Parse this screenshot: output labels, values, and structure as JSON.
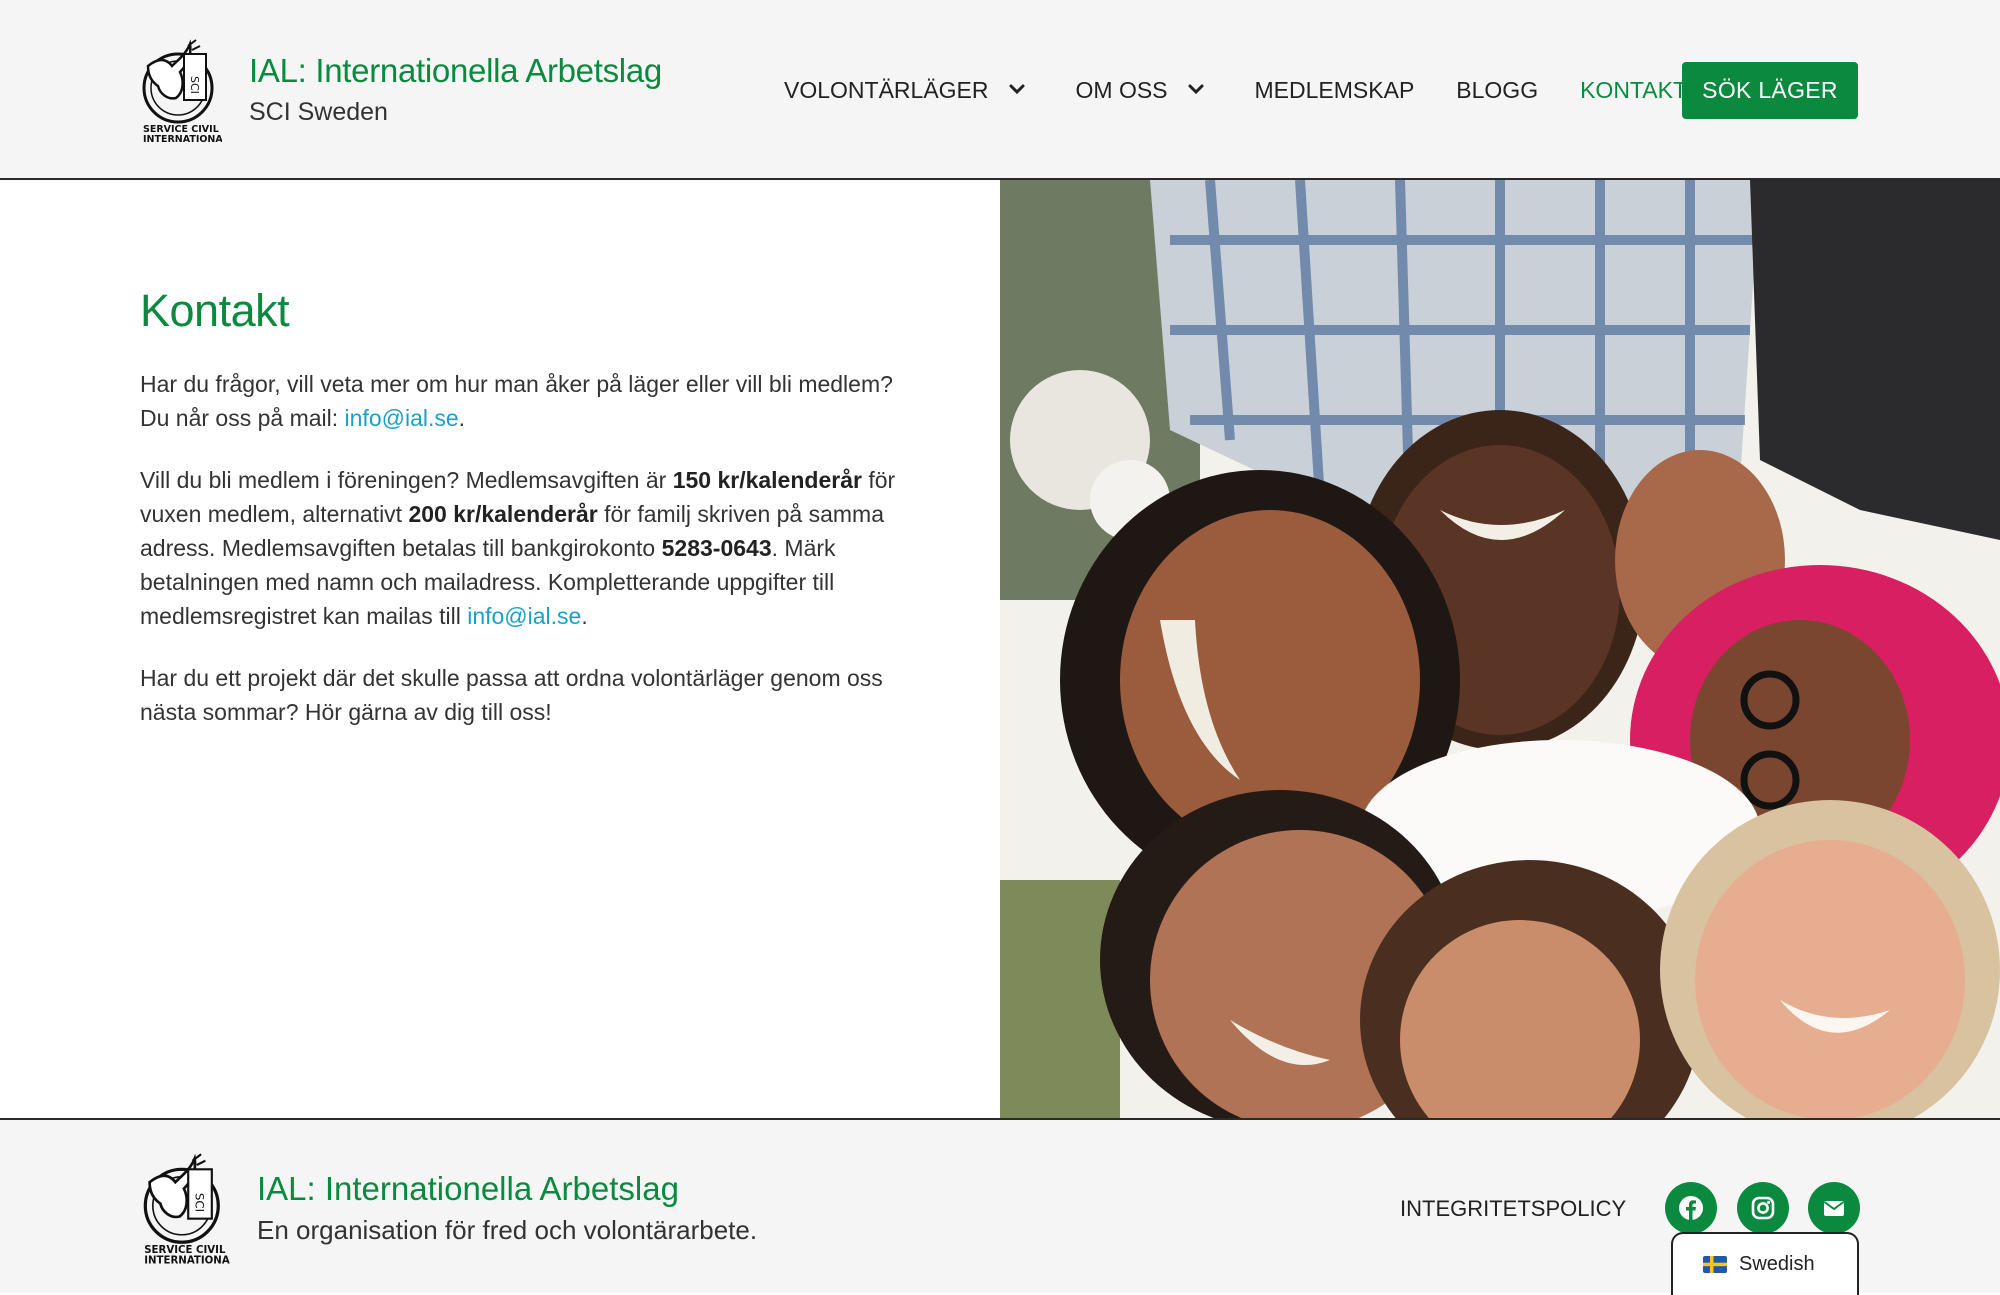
{
  "header": {
    "brand_title": "IAL: Internationella Arbetslag",
    "brand_subtitle": "SCI Sweden",
    "logo_text": "SERVICE CIVIL INTERNATIONAL"
  },
  "nav": {
    "items": [
      {
        "label": "VOLONTÄRLÄGER",
        "has_dropdown": true
      },
      {
        "label": "OM OSS",
        "has_dropdown": true
      },
      {
        "label": "MEDLEMSKAP",
        "has_dropdown": false
      },
      {
        "label": "BLOGG",
        "has_dropdown": false
      },
      {
        "label": "KONTAKT",
        "has_dropdown": false,
        "active": true
      }
    ],
    "cta_label": "SÖK LÄGER"
  },
  "main": {
    "heading": "Kontakt",
    "p1_text": "Har du frågor, vill veta mer om hur man åker på läger eller vill bli medlem? Du når oss på mail: ",
    "p1_link": "info@ial.se",
    "p1_end": ".",
    "p2_a": "Vill du bli medlem i föreningen? Medlemsavgiften är ",
    "p2_b": "150 kr/kalenderår",
    "p2_c": " för vuxen medlem, alternativt ",
    "p2_d": "200 kr/kalenderår",
    "p2_e": " för familj skriven på samma adress. Medlemsavgiften betalas till bankgirokonto ",
    "p2_f": "5283-0643",
    "p2_g": ". Märk betalningen med namn och mailadress. Kompletterande uppgifter till medlemsregistret kan mailas till ",
    "p2_link": "info@ial.se",
    "p2_end": ".",
    "p3": "Har du ett projekt där det skulle passa att ordna volontärläger genom oss nästa sommar? Hör gärna av dig till oss!"
  },
  "footer": {
    "title": "IAL: Internationella Arbetslag",
    "tagline": "En organisation för fred och volontärarbete.",
    "policy_label": "INTEGRITETSPOLICY",
    "social_icons": [
      "facebook-icon",
      "instagram-icon",
      "envelope-icon"
    ],
    "language_label": "Swedish"
  },
  "colors": {
    "brand_green": "#0b8a3f",
    "link_blue": "#1aa0c8",
    "header_bg": "#f5f5f5"
  }
}
